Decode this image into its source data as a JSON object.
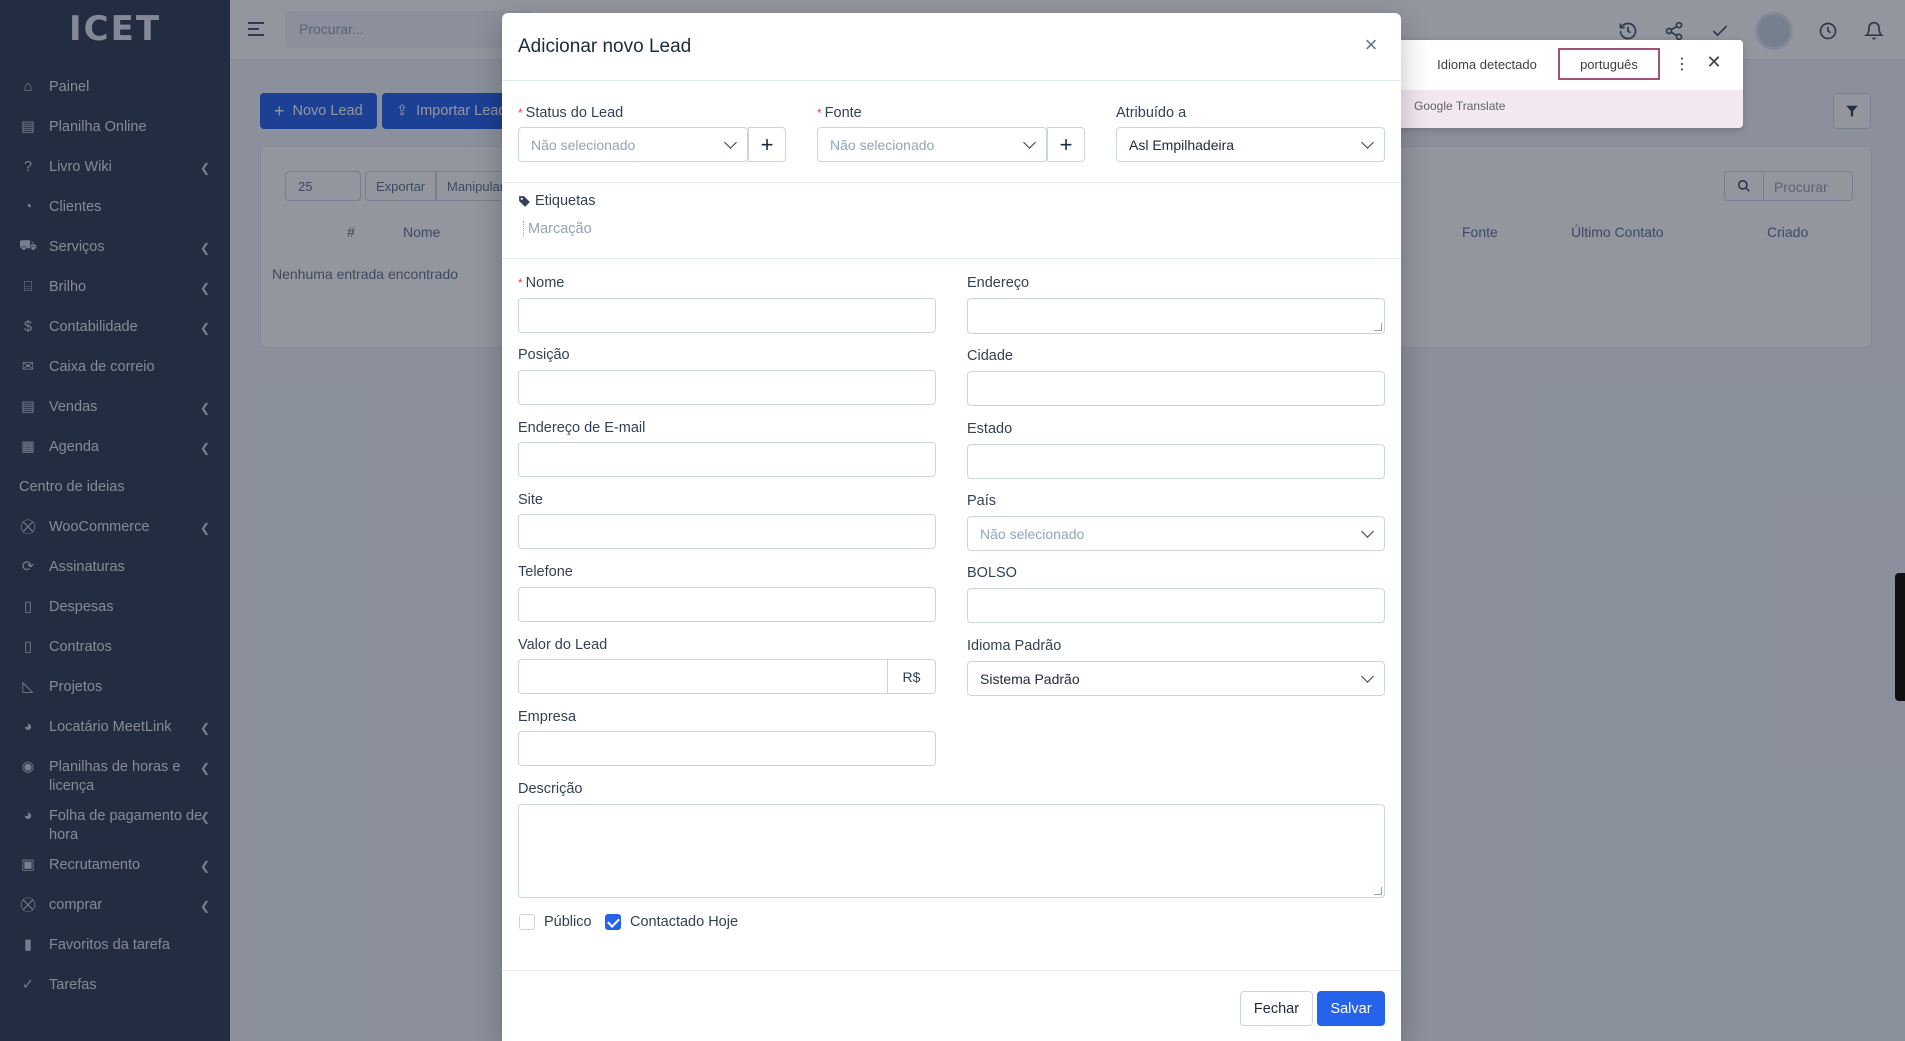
{
  "app": {
    "logo_text": "ICET"
  },
  "sidebar": {
    "items": [
      {
        "label": "Painel",
        "icon": "home-icon",
        "has_children": false
      },
      {
        "label": "Planilha Online",
        "icon": "document-icon",
        "has_children": false
      },
      {
        "label": "Livro Wiki",
        "icon": "help-circle-icon",
        "has_children": true
      },
      {
        "label": "Clientes",
        "icon": "user-icon",
        "has_children": false
      },
      {
        "label": "Serviços",
        "icon": "truck-icon",
        "has_children": true
      },
      {
        "label": "Brilho",
        "icon": "bank-icon",
        "has_children": true
      },
      {
        "label": "Contabilidade",
        "icon": "dollar-icon",
        "has_children": true
      },
      {
        "label": "Caixa de correio",
        "icon": "envelope-icon",
        "has_children": false
      },
      {
        "label": "Vendas",
        "icon": "receipt-icon",
        "has_children": true
      },
      {
        "label": "Agenda",
        "icon": "calendar-icon",
        "has_children": true
      },
      {
        "label": "Centro de ideias",
        "icon": "",
        "has_children": false
      },
      {
        "label": "WooCommerce",
        "icon": "cart-icon",
        "has_children": true
      },
      {
        "label": "Assinaturas",
        "icon": "refresh-icon",
        "has_children": false
      },
      {
        "label": "Despesas",
        "icon": "file-icon",
        "has_children": false
      },
      {
        "label": "Contratos",
        "icon": "file-icon",
        "has_children": false
      },
      {
        "label": "Projetos",
        "icon": "chart-icon",
        "has_children": false
      },
      {
        "label": "Locatário MeetLink",
        "icon": "users-icon",
        "has_children": true
      },
      {
        "label": "Planilhas de horas e licença",
        "icon": "user-circle-icon",
        "has_children": true
      },
      {
        "label": "Folha de pagamento de hora",
        "icon": "users-icon",
        "has_children": true
      },
      {
        "label": "Recrutamento",
        "icon": "id-card-icon",
        "has_children": true
      },
      {
        "label": "comprar",
        "icon": "cart-icon",
        "has_children": true
      },
      {
        "label": "Favoritos da tarefa",
        "icon": "bookmark-icon",
        "has_children": false
      },
      {
        "label": "Tarefas",
        "icon": "check-circle-icon",
        "has_children": false
      }
    ]
  },
  "topbar": {
    "search_placeholder": "Procurar..."
  },
  "page": {
    "new_lead_label": "Novo Lead",
    "import_label": "Importar Leads",
    "page_size": "25",
    "export_label": "Exportar",
    "bulk_label": "Manipular",
    "search_placeholder": "Procurar",
    "columns": [
      "#",
      "Nome",
      "Fonte",
      "Último Contato",
      "Criado"
    ],
    "empty_text": "Nenhuma entrada encontrado"
  },
  "modal": {
    "title": "Adicionar novo Lead",
    "status_label": "Status do Lead",
    "status_value": "Não selecionado",
    "source_label": "Fonte",
    "source_value": "Não selecionado",
    "assigned_label": "Atribuído a",
    "assigned_value": "Asl Empilhadeira",
    "tags_label": "Etiquetas",
    "tags_placeholder": "Marcação",
    "name_label": "Nome",
    "address_label": "Endereço",
    "position_label": "Posição",
    "city_label": "Cidade",
    "email_label": "Endereço de E-mail",
    "state_label": "Estado",
    "website_label": "Site",
    "country_label": "País",
    "country_value": "Não selecionado",
    "phone_label": "Telefone",
    "zip_label": "BOLSO",
    "lead_value_label": "Valor do Lead",
    "currency": "R$",
    "default_language_label": "Idioma Padrão",
    "default_language_value": "Sistema Padrão",
    "company_label": "Empresa",
    "description_label": "Descrição",
    "public_label": "Público",
    "public_checked": false,
    "contacted_today_label": "Contactado Hoje",
    "contacted_today_checked": true,
    "close_button": "Fechar",
    "save_button": "Salvar"
  },
  "translate_popup": {
    "detected_label": "Idioma detectado",
    "language": "português",
    "brand": "Google Translate"
  },
  "colors": {
    "sidebar": "#334155",
    "primary": "#2563eb",
    "required": "#ef4444"
  }
}
